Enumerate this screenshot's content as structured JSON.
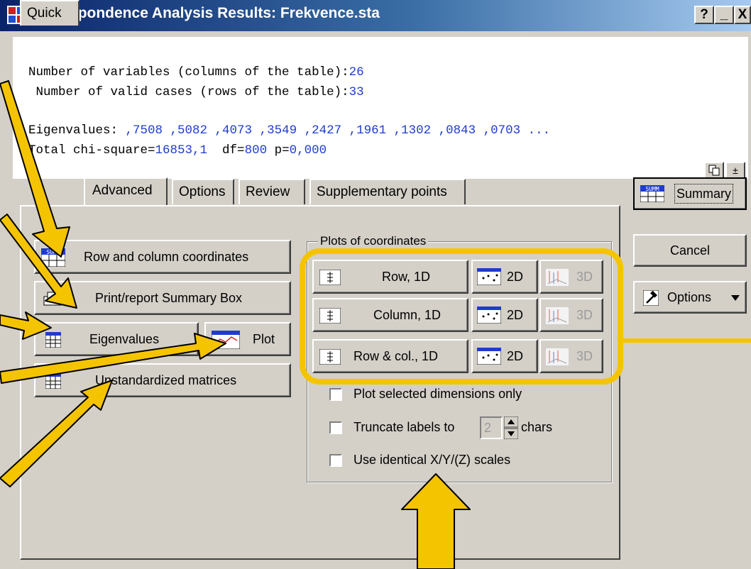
{
  "window": {
    "title": "Correspondence Analysis Results: Frekvence.sta",
    "controls": {
      "help": "?",
      "minimize": "_",
      "close": "X"
    }
  },
  "output": {
    "line1_label": "Number of variables (columns of the table):",
    "line1_value": "26",
    "line2_label": " Number of valid cases (rows of the table):",
    "line2_value": "33",
    "eigen_label": "Eigenvalues: ",
    "eigen_values": ",7508 ,5082 ,4073 ,3549 ,2427 ,1961 ,1302 ,0843 ,0703 ...",
    "chi_label": "Total chi-square=",
    "chi_value": "16853,1",
    "df_label": "  df=",
    "df_value": "800",
    "p_label": " p=",
    "p_value": "0,000",
    "copy_icon": "copy-icon",
    "collapse_icon": "collapse-icon",
    "collapse_glyph": "±"
  },
  "tabs": [
    "Quick",
    "Advanced",
    "Options",
    "Review",
    "Supplementary points"
  ],
  "active_tab": "Advanced",
  "left_buttons": {
    "row_col": "Row and column coordinates",
    "print": "Print/report Summary Box",
    "eigen": "Eigenvalues",
    "plot": "Plot",
    "unstd": "Unstandardized matrices"
  },
  "plots_group": {
    "title": "Plots of coordinates",
    "rows": [
      {
        "label": "Row, 1D",
        "two_d": "2D",
        "three_d": "3D"
      },
      {
        "label": "Column, 1D",
        "two_d": "2D",
        "three_d": "3D"
      },
      {
        "label": "Row & col., 1D",
        "two_d": "2D",
        "three_d": "3D"
      }
    ],
    "check_selected": "Plot selected dimensions only",
    "check_truncate": "Truncate labels to",
    "truncate_value": "2",
    "truncate_unit": "chars",
    "check_identical": "Use identical X/Y/(Z) scales"
  },
  "right_buttons": {
    "summary": "Summary",
    "cancel": "Cancel",
    "options": "Options"
  },
  "colors": {
    "highlight": "#f5c400",
    "title_blue": "#0a246a",
    "output_blue": "#1f3ccc"
  }
}
